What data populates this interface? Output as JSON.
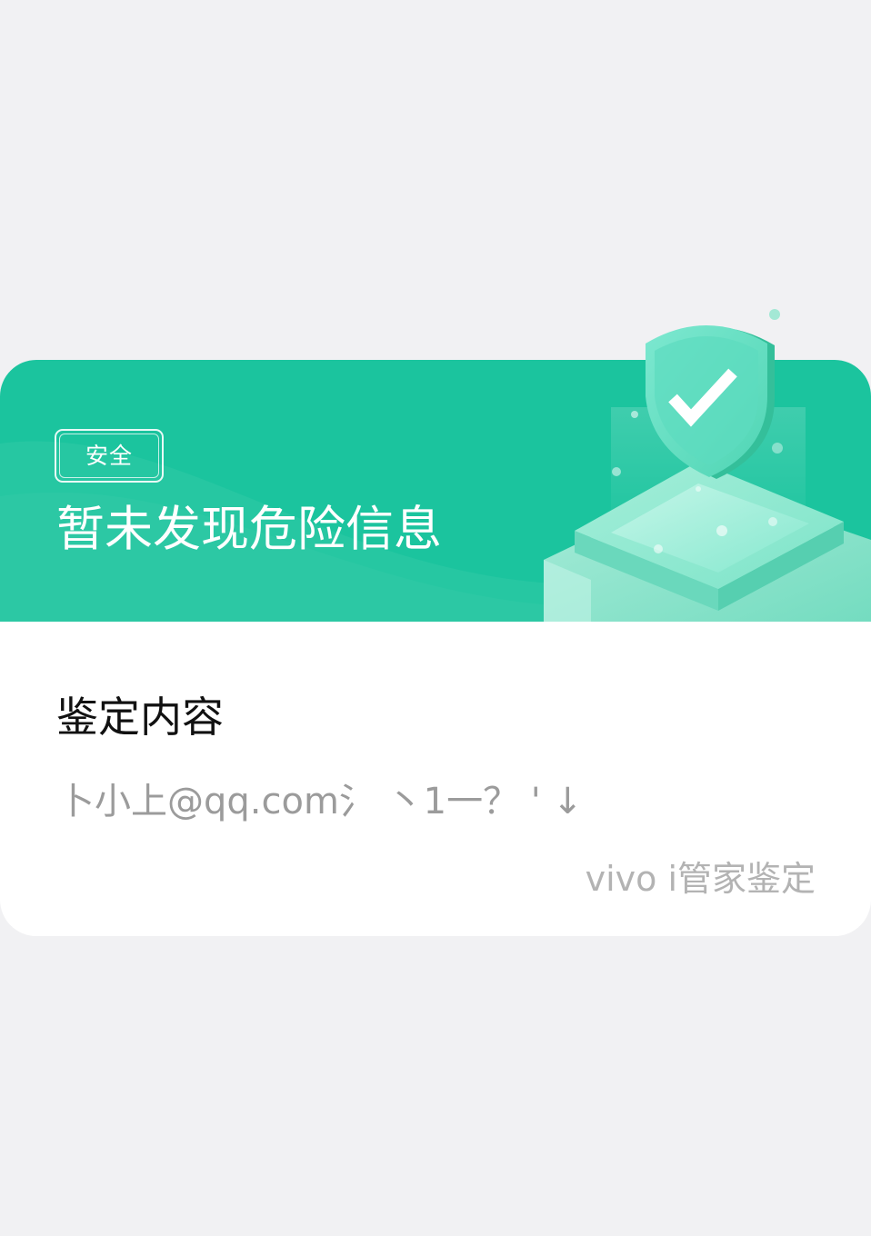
{
  "card": {
    "header": {
      "badge": "安全",
      "title": "暂未发现危险信息",
      "illustration_icon": "shield-check-icon"
    },
    "body": {
      "section_title": "鉴定内容",
      "content": "卜小上@qq.com氵 丶1一？ ' ↓",
      "attribution": "vivo i管家鉴定"
    }
  },
  "colors": {
    "page_background": "#f1f1f3",
    "header_green": "#1bc49e",
    "card_background": "#ffffff",
    "title_text": "#ffffff",
    "section_title_text": "#111111",
    "content_text": "#9b9b9b",
    "attribution_text": "#b3b3b3"
  }
}
